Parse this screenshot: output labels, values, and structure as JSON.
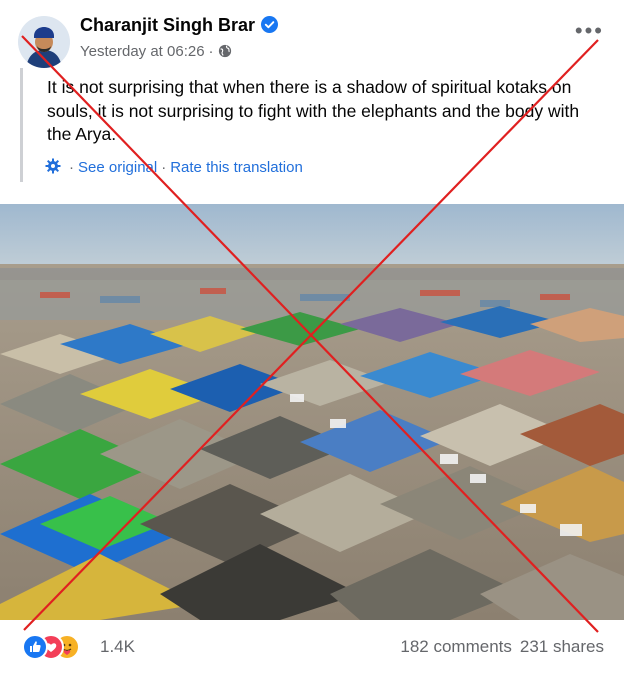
{
  "post": {
    "author": "Charanjit Singh Brar",
    "timestamp": "Yesterday at 06:26",
    "dot": "·",
    "more_label": "•••",
    "text": "It is not surprising that when there is a shadow of spiritual kotaks on souls, it is not surprising to fight with the elephants and the body with the Arya.",
    "see_original": "See original",
    "rate_translation": "Rate this translation",
    "separator": "·"
  },
  "footer": {
    "reaction_count": "1.4K",
    "comments": "182 comments",
    "shares": "231 shares"
  },
  "icons": {
    "verified": "verified-badge-icon",
    "globe": "globe-icon",
    "gear": "gear-icon",
    "like": "like-reaction-icon",
    "love": "love-reaction-icon",
    "care": "care-reaction-icon"
  },
  "colors": {
    "link_blue": "#216fdb",
    "verified_blue": "#1877f2",
    "secondary_text": "#65676b",
    "overlay_cross": "#e02020"
  }
}
